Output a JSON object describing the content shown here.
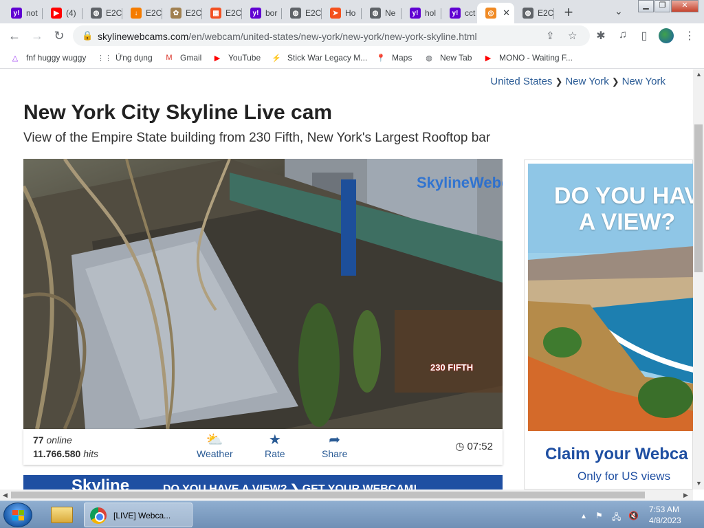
{
  "tabs": [
    {
      "label": "not",
      "icon": "yahoo-icon",
      "color": "#6001d2",
      "glyph": "y!"
    },
    {
      "label": "(4)",
      "icon": "youtube-icon",
      "color": "#ff0000",
      "glyph": "▶"
    },
    {
      "label": "E2C",
      "icon": "globe-icon",
      "color": "#5f6368",
      "glyph": "◍"
    },
    {
      "label": "E2C",
      "icon": "download-icon",
      "color": "#f57c00",
      "glyph": "↓"
    },
    {
      "label": "E2C",
      "icon": "image-icon",
      "color": "#a08050",
      "glyph": "✿"
    },
    {
      "label": "E2C",
      "icon": "microsoft-icon",
      "color": "#f25022",
      "glyph": "▦"
    },
    {
      "label": "bor",
      "icon": "yahoo-icon",
      "color": "#6001d2",
      "glyph": "y!"
    },
    {
      "label": "E2C",
      "icon": "globe-icon",
      "color": "#5f6368",
      "glyph": "◍"
    },
    {
      "label": "Ho",
      "icon": "pin-icon",
      "color": "#f4511e",
      "glyph": "➤"
    },
    {
      "label": "Ne",
      "icon": "globe-icon",
      "color": "#5f6368",
      "glyph": "◍"
    },
    {
      "label": "hol",
      "icon": "yahoo-icon",
      "color": "#6001d2",
      "glyph": "y!"
    },
    {
      "label": "cct",
      "icon": "yahoo-icon",
      "color": "#6001d2",
      "glyph": "y!"
    },
    {
      "label": "",
      "icon": "skylinewebcams-icon",
      "color": "#f08a24",
      "glyph": "◎",
      "active": true
    },
    {
      "label": "E2C",
      "icon": "globe-icon",
      "color": "#5f6368",
      "glyph": "◍"
    }
  ],
  "toolbar": {
    "url_host": "skylinewebcams.com",
    "url_path": "/en/webcam/united-states/new-york/new-york/new-york-skyline.html"
  },
  "bookmarks": [
    {
      "label": "fnf huggy wuggy",
      "icon": "triangle-icon",
      "glyph": "△",
      "color": "#a142f4"
    },
    {
      "label": "Ứng dụng",
      "icon": "apps-icon",
      "glyph": "⋮⋮",
      "color": "#5f6368"
    },
    {
      "label": "Gmail",
      "icon": "gmail-icon",
      "glyph": "M",
      "color": "#d93025"
    },
    {
      "label": "YouTube",
      "icon": "youtube-icon",
      "glyph": "▶",
      "color": "#ff0000"
    },
    {
      "label": "Stick War Legacy M...",
      "icon": "lightning-icon",
      "glyph": "⚡",
      "color": "#1e8e3e"
    },
    {
      "label": "Maps",
      "icon": "maps-icon",
      "glyph": "📍",
      "color": "#34a853"
    },
    {
      "label": "New Tab",
      "icon": "globe-icon",
      "glyph": "◍",
      "color": "#5f6368"
    },
    {
      "label": "MONO - Waiting F...",
      "icon": "youtube-icon",
      "glyph": "▶",
      "color": "#ff0000"
    }
  ],
  "page": {
    "breadcrumb": [
      "United States",
      "New York",
      "New York"
    ],
    "title": "New York City Skyline Live cam",
    "subtitle": "View of the Empire State building from 230 Fifth, New York's Largest Rooftop bar",
    "cam_overlay_brand": "SkylineWebcams",
    "cam_overlay_sign": "230 FIFTH",
    "online_count": "77",
    "online_label": "online",
    "hits_count": "11.766.580",
    "hits_label": "hits",
    "actions": [
      {
        "label": "Weather",
        "icon": "weather-icon",
        "glyph": "⛅"
      },
      {
        "label": "Rate",
        "icon": "star-icon",
        "glyph": "★"
      },
      {
        "label": "Share",
        "icon": "share-icon",
        "glyph": "➦"
      }
    ],
    "clock": "07:52",
    "banner_logo": "Skyline",
    "banner_text": "DO YOU HAVE A VIEW? ❯ GET YOUR WEBCAM!",
    "ad_headline_1": "DO YOU HAV",
    "ad_headline_2": "A VIEW?",
    "ad_claim": "Claim your Webca",
    "ad_only": "Only for US views"
  },
  "taskbar": {
    "chrome_label": "[LIVE] Webca...",
    "time": "7:53 AM",
    "date": "4/8/2023"
  },
  "colors": {
    "link": "#2a5b95",
    "brand_blue": "#1f4fa2"
  }
}
